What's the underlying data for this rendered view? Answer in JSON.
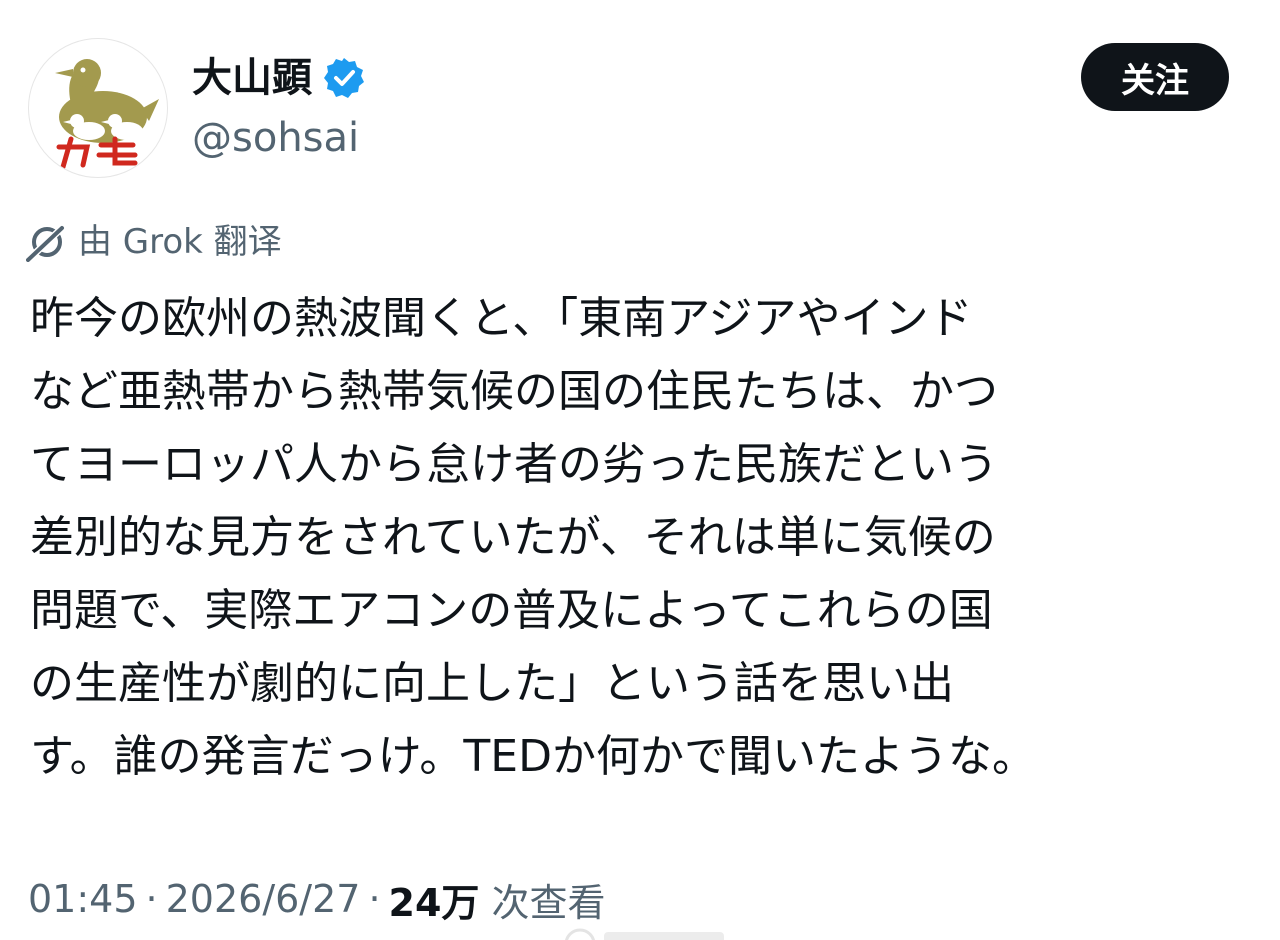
{
  "author": {
    "display_name": "大山顕",
    "handle": "@sohsai",
    "avatar_text": "カモ",
    "verified_icon": "verified-badge-icon",
    "badge_color": "#1d9bf0"
  },
  "follow_button": {
    "label": "关注"
  },
  "translation": {
    "label": "由 Grok 翻译",
    "icon": "grok-icon"
  },
  "tweet": {
    "lines": [
      "昨今の欧州の熱波聞くと、「東南アジアやインド",
      "など亜熱帯から熱帯気候の国の住民たちは、かつ",
      "てヨーロッパ人から怠け者の劣った民族だという",
      "差別的な見方をされていたが、それは単に気候の",
      "問題で、実際エアコンの普及によってこれらの国",
      "の生産性が劇的に向上した」という話を思い出",
      "す。誰の発言だっけ。TEDか何かで聞いたような。"
    ]
  },
  "meta": {
    "time": "01:45",
    "separator": "·",
    "date": "2026/6/27",
    "views_count": "24万",
    "views_label": "次查看"
  },
  "colors": {
    "text_primary": "#0f1419",
    "text_secondary": "#536471",
    "button_bg": "#0f1419",
    "avatar_duck": "#a39a4e",
    "avatar_text": "#d0281e"
  }
}
